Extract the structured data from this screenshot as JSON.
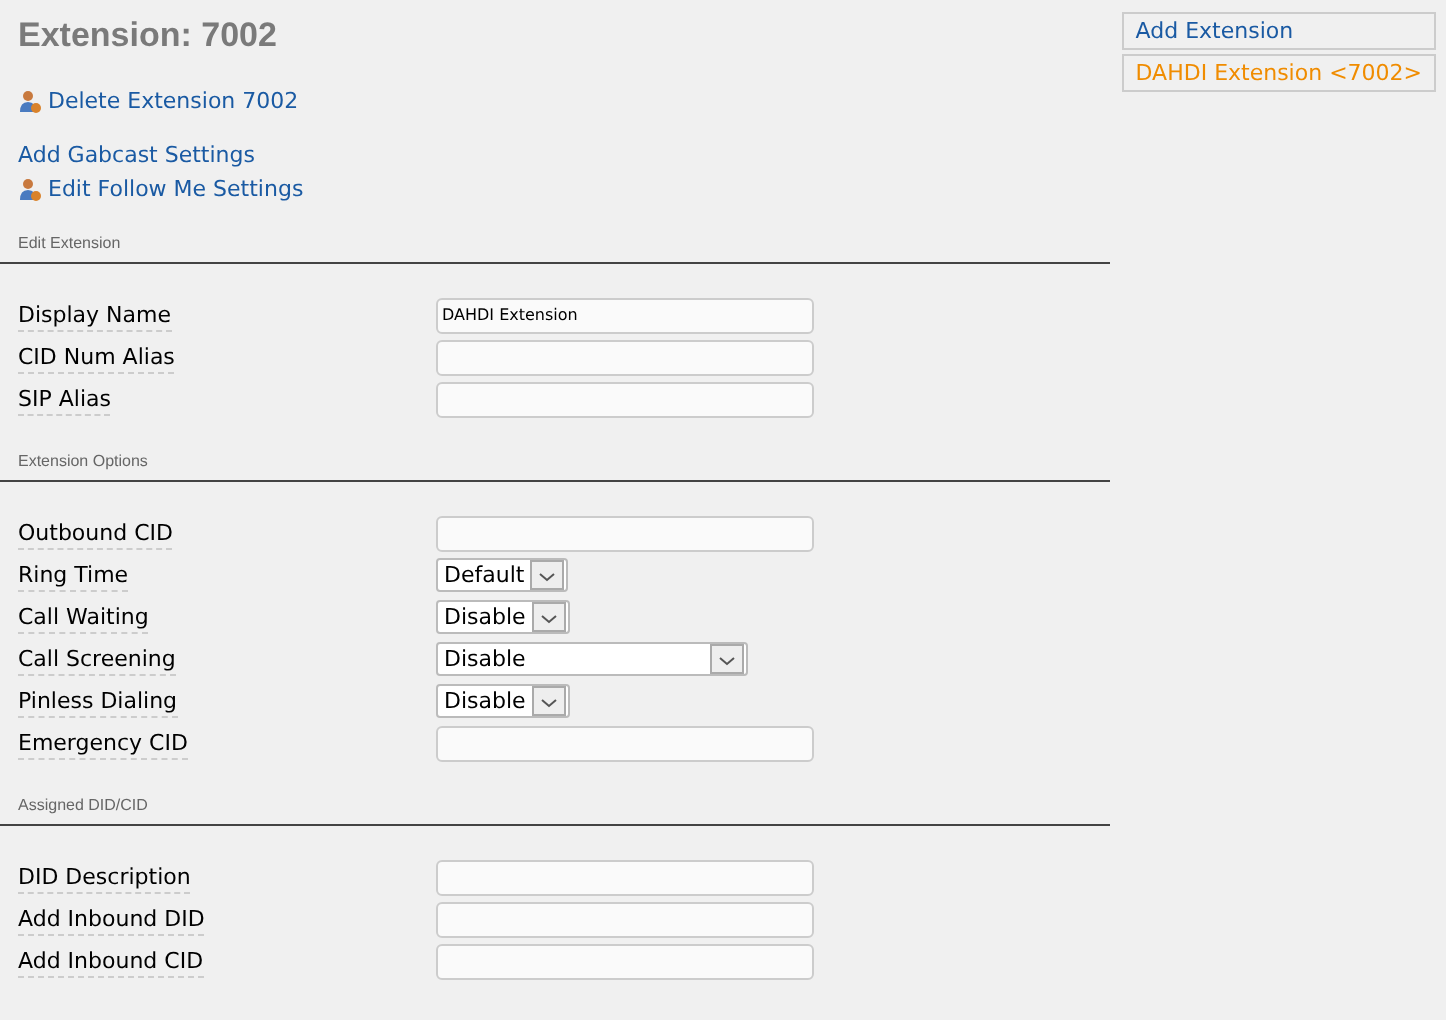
{
  "title": "Extension: 7002",
  "links": [
    {
      "kind": "icon-link",
      "label": "Delete Extension 7002"
    },
    {
      "kind": "plain-link",
      "label": "Add Gabcast Settings"
    },
    {
      "kind": "icon-link",
      "label": "Edit Follow Me Settings"
    }
  ],
  "sections": [
    {
      "heading": "Edit Extension",
      "fields": [
        {
          "kind": "text",
          "label": "Display Name",
          "value": "DAHDI Extension"
        },
        {
          "kind": "text",
          "label": "CID Num Alias"
        },
        {
          "kind": "text",
          "label": "SIP Alias"
        }
      ]
    },
    {
      "heading": "Extension Options",
      "fields": [
        {
          "kind": "text",
          "label": "Outbound CID"
        },
        {
          "kind": "select",
          "label": "Ring Time",
          "value": "Default",
          "wide": false
        },
        {
          "kind": "select",
          "label": "Call Waiting",
          "value": "Disable",
          "wide": false
        },
        {
          "kind": "select",
          "label": "Call Screening",
          "value": "Disable",
          "wide": true
        },
        {
          "kind": "select",
          "label": "Pinless Dialing",
          "value": "Disable",
          "wide": false
        },
        {
          "kind": "text",
          "label": "Emergency CID"
        }
      ]
    },
    {
      "heading": "Assigned DID/CID",
      "fields": [
        {
          "kind": "text",
          "label": "DID Description"
        },
        {
          "kind": "text",
          "label": "Add Inbound DID"
        },
        {
          "kind": "text",
          "label": "Add Inbound CID"
        }
      ]
    }
  ],
  "sidebar": {
    "items": [
      {
        "label": "Add Extension",
        "selected": false
      },
      {
        "label": "DAHDI Extension <7002>",
        "selected": true
      }
    ]
  }
}
